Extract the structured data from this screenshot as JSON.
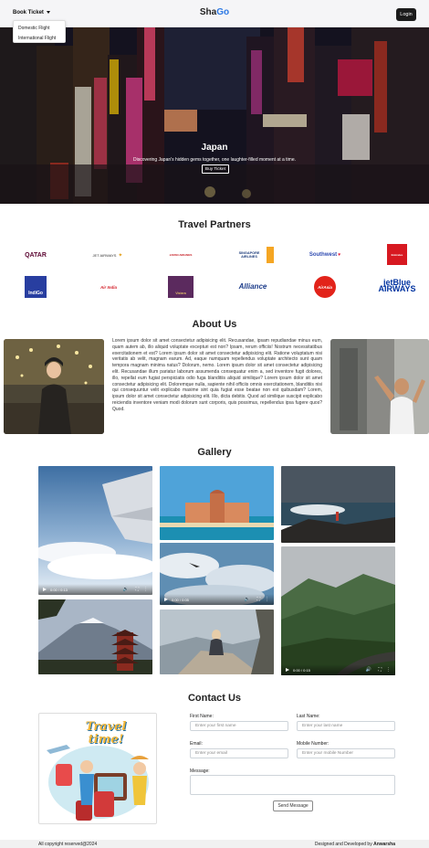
{
  "nav": {
    "dropdown_label": "Book Ticket",
    "dropdown_items": [
      "Domestic Flight",
      "International Flight"
    ],
    "brand_part1": "Sha",
    "brand_part2": "Go",
    "login_label": "Login"
  },
  "hero": {
    "title": "Japan",
    "subtitle": "Discovering Japan's hidden gems together, one laughter-filled moment at a time.",
    "button": "Buy Ticket"
  },
  "partners": {
    "title": "Travel Partners",
    "logos": [
      "QATAR",
      "JET AIRWAYS",
      "JAPAN AIRLINES",
      "SINGAPORE AIRLINES",
      "Southwest",
      "Emirates",
      "IndiGo",
      "Air India",
      "Vistara",
      "Alliance",
      "AirAsia",
      "jetBlue AIRWAYS"
    ]
  },
  "about": {
    "title": "About Us",
    "text": "Lorem ipsum dolor sit amet consectetur adipisicing elit. Recusandae, ipsam repudiandae minus eum, quam autem ab, illo aliquid voluptate excepturi est non? Ipsam, rerum officiis! Nostrum necessitatibus exercitationem et est? Lorem ipsum dolor sit amet consectetur adipisicing elit. Ratione voluptatum nisi veritatis ab velit, magnam earum. Ad, eaque numquam repellendus voluptate architecto sunt quam tempora magnam minima natus? Dolorum, nemo. Lorem ipsum dolor sit amet consectetur adipisicing elit. Recusandae illum pariatur laborum assumenda consequatur enim a, sed inventore fugit dolores, illo, repellat eum fugiat perspiciatis odio fuga blanditiis aliquid similique? Lorem ipsum dolor sit amet consectetur adipisicing elit. Doloremque nulla, sapiente nihil officiis omnis exercitationem, blanditiis nisi qui consequuntur velit explicabo maxime sint quia fugiat esse beatae non est quibusdam? Lorem, ipsum dolor sit amet consectetur adipisicing elit. Illo, dicta debitis. Quod ad similique suscipit explicabo reiciendis inventore veniam modi dolorum sunt corporis, quis possimus, repellendus ipsa fugere quos? Quod."
  },
  "gallery": {
    "title": "Gallery",
    "video1_time": "0:00 / 0:13",
    "video2_time": "0:00 / 0:05",
    "video3_time": "0:00 / 0:15"
  },
  "contact": {
    "title": "Contact Us",
    "image_text": "Travel time!",
    "first_name_label": "First Name:",
    "first_name_placeholder": "Enter your first name",
    "last_name_label": "Last Name:",
    "last_name_placeholder": "Enter your last name",
    "email_label": "Email:",
    "email_placeholder": "Enter your email",
    "mobile_label": "Mobile Number:",
    "mobile_placeholder": "Enter your mobile Number",
    "message_label": "Message:",
    "submit_label": "Send Message"
  },
  "footer": {
    "copyright": "All copyright reserved@2024",
    "credit_prefix": "Designed and Developed by",
    "credit_name": "Anwarsha"
  }
}
